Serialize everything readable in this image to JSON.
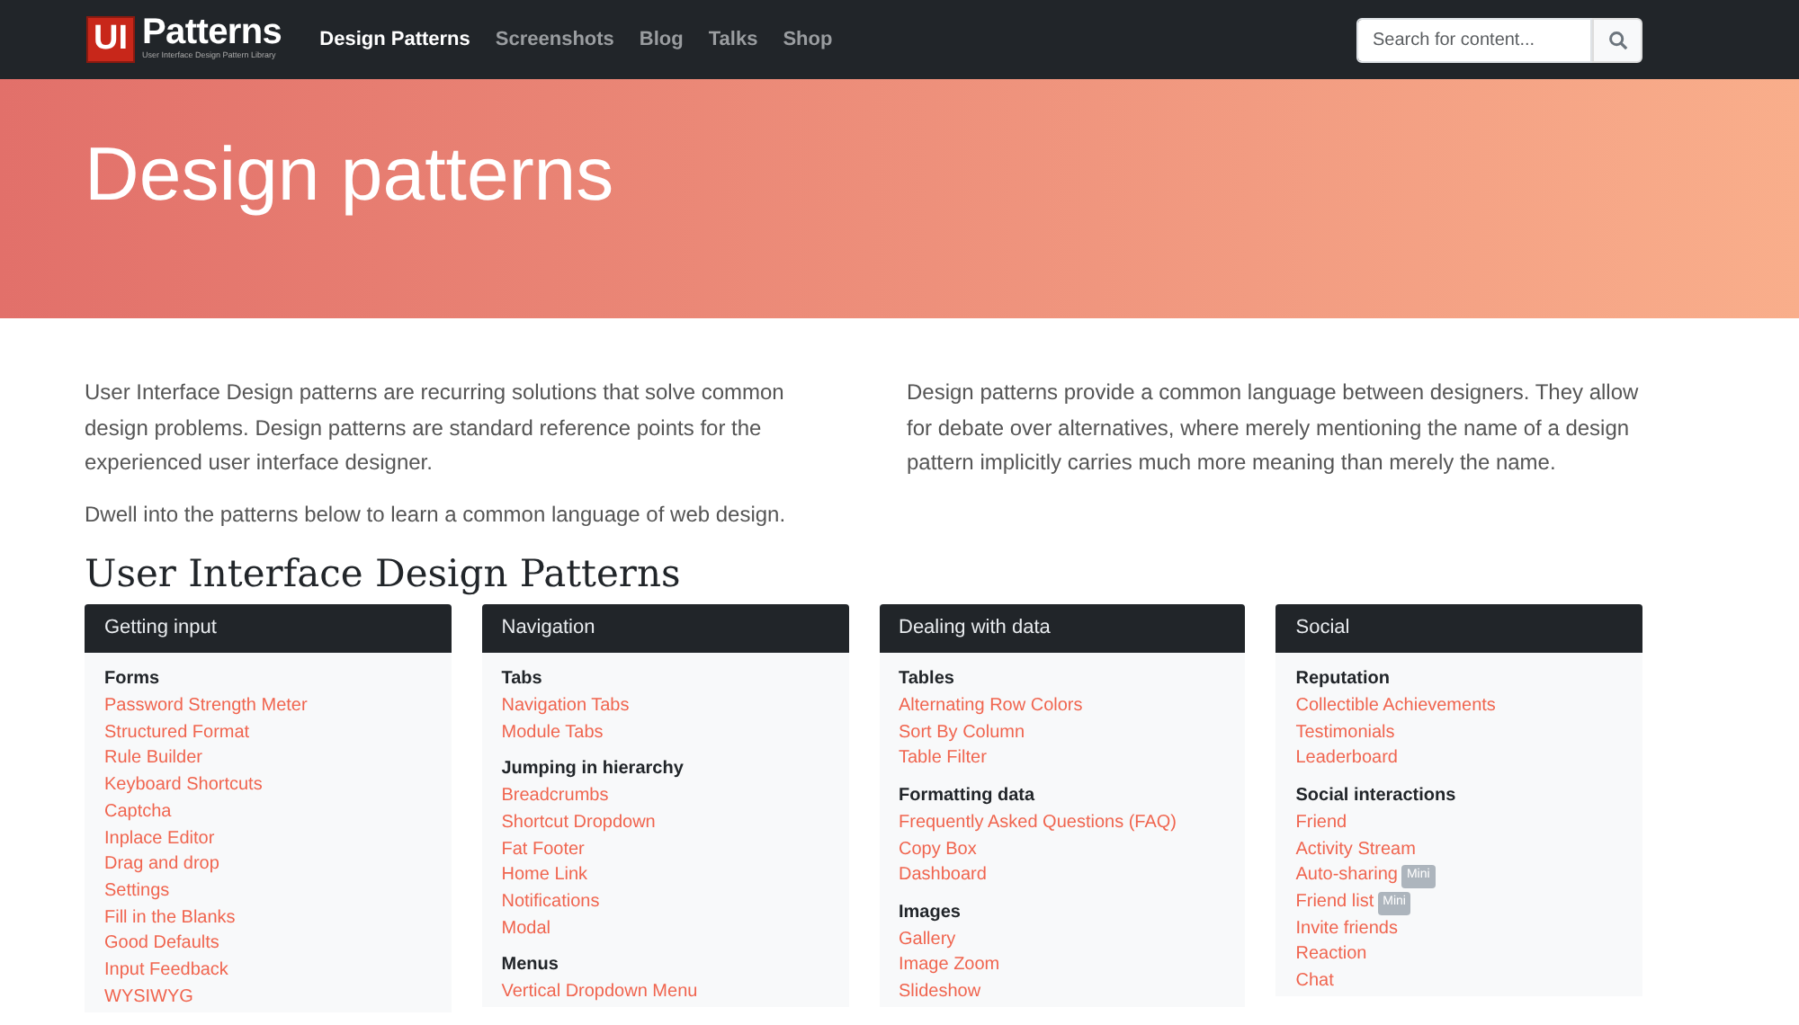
{
  "logo": {
    "mark": "UI",
    "name": "Patterns",
    "tagline": "User Interface Design Pattern Library"
  },
  "nav": [
    {
      "label": "Design Patterns",
      "selected": true
    },
    {
      "label": "Screenshots",
      "selected": false
    },
    {
      "label": "Blog",
      "selected": false
    },
    {
      "label": "Talks",
      "selected": false
    },
    {
      "label": "Shop",
      "selected": false
    }
  ],
  "search": {
    "placeholder": "Search for content..."
  },
  "hero": {
    "title": "Design patterns"
  },
  "intro": {
    "left": [
      "User Interface Design patterns are recurring solutions that solve common design problems. Design patterns are standard reference points for the experienced user interface designer.",
      "Dwell into the patterns below to learn a common language of web design."
    ],
    "right": [
      "Design patterns provide a common language between designers. They allow for debate over alternatives, where merely mentioning the name of a design pattern implicitly carries much more meaning than merely the name."
    ]
  },
  "section_title": "User Interface Design Patterns",
  "cards": [
    {
      "title": "Getting input",
      "groups": [
        {
          "title": "Forms",
          "items": [
            {
              "label": "Password Strength Meter"
            },
            {
              "label": "Structured Format"
            },
            {
              "label": "Rule Builder"
            },
            {
              "label": "Keyboard Shortcuts"
            },
            {
              "label": "Captcha"
            },
            {
              "label": "Inplace Editor"
            },
            {
              "label": "Drag and drop"
            },
            {
              "label": "Settings"
            },
            {
              "label": "Fill in the Blanks"
            },
            {
              "label": "Good Defaults"
            },
            {
              "label": "Input Feedback"
            },
            {
              "label": "WYSIWYG"
            }
          ]
        }
      ]
    },
    {
      "title": "Navigation",
      "groups": [
        {
          "title": "Tabs",
          "items": [
            {
              "label": "Navigation Tabs"
            },
            {
              "label": "Module Tabs"
            }
          ]
        },
        {
          "title": "Jumping in hierarchy",
          "items": [
            {
              "label": "Breadcrumbs"
            },
            {
              "label": "Shortcut Dropdown"
            },
            {
              "label": "Fat Footer"
            },
            {
              "label": "Home Link"
            },
            {
              "label": "Notifications"
            },
            {
              "label": "Modal"
            }
          ]
        },
        {
          "title": "Menus",
          "items": [
            {
              "label": "Vertical Dropdown Menu"
            }
          ]
        }
      ]
    },
    {
      "title": "Dealing with data",
      "groups": [
        {
          "title": "Tables",
          "items": [
            {
              "label": "Alternating Row Colors"
            },
            {
              "label": "Sort By Column"
            },
            {
              "label": "Table Filter"
            }
          ]
        },
        {
          "title": "Formatting data",
          "items": [
            {
              "label": "Frequently Asked Questions (FAQ)"
            },
            {
              "label": "Copy Box"
            },
            {
              "label": "Dashboard"
            }
          ]
        },
        {
          "title": "Images",
          "items": [
            {
              "label": "Gallery"
            },
            {
              "label": "Image Zoom"
            },
            {
              "label": "Slideshow"
            }
          ]
        }
      ]
    },
    {
      "title": "Social",
      "groups": [
        {
          "title": "Reputation",
          "items": [
            {
              "label": "Collectible Achievements"
            },
            {
              "label": "Testimonials"
            },
            {
              "label": "Leaderboard"
            }
          ]
        },
        {
          "title": "Social interactions",
          "items": [
            {
              "label": "Friend"
            },
            {
              "label": "Activity Stream"
            },
            {
              "label": "Auto-sharing",
              "badge": "Mini"
            },
            {
              "label": "Friend list",
              "badge": "Mini"
            },
            {
              "label": "Invite friends"
            },
            {
              "label": "Reaction"
            },
            {
              "label": "Chat"
            }
          ]
        }
      ]
    }
  ]
}
